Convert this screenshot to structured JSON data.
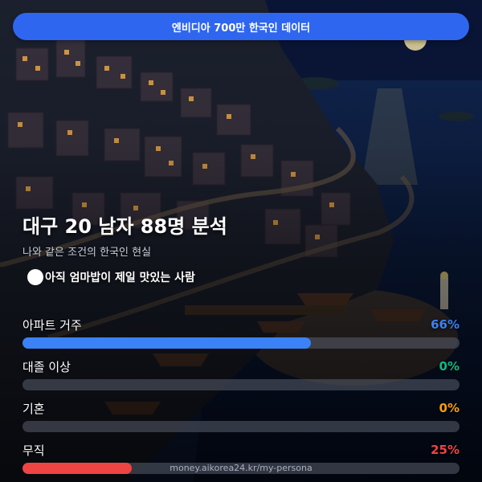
{
  "banner": {
    "text": "엔비디아 700만 한국인 데이터"
  },
  "header": {
    "title": "대구 20 남자 88명 분석",
    "subtitle": "나와 같은 조건의 한국인 현실"
  },
  "persona": {
    "text": "아직 엄마밥이 제일 맛있는 사람"
  },
  "stats": [
    {
      "label": "아파트 거주",
      "value": "66%",
      "fraction": 0.66,
      "color": "#3b82f6"
    },
    {
      "label": "대졸 이상",
      "value": "0%",
      "fraction": 0.0,
      "color": "#10b981"
    },
    {
      "label": "기혼",
      "value": "0%",
      "fraction": 0.0,
      "color": "#f59e0b"
    },
    {
      "label": "무직",
      "value": "25%",
      "fraction": 0.25,
      "color": "#ef4444"
    }
  ],
  "footer": {
    "text": "money.aikorea24.kr/my-persona"
  }
}
